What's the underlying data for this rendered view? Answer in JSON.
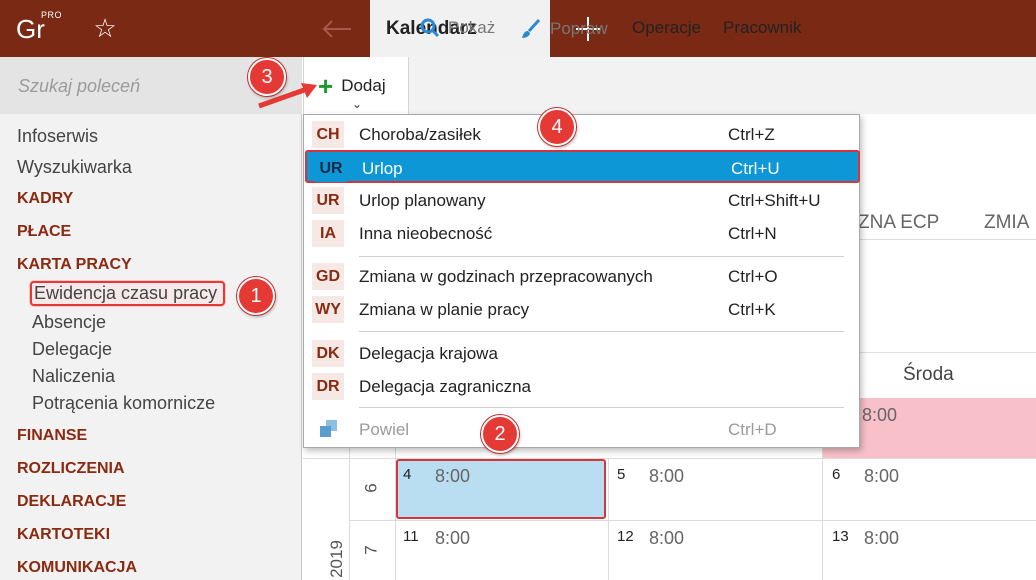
{
  "app": {
    "logo": "Gr",
    "logo_badge": "PRO"
  },
  "tabs": {
    "active": "Kalendarz"
  },
  "sidebar": {
    "search_placeholder": "Szukaj poleceń",
    "items": [
      "Infoserwis",
      "Wyszukiwarka"
    ],
    "sections": [
      "KADRY",
      "PŁACE",
      "KARTA PRACY",
      "FINANSE",
      "ROZLICZENIA",
      "DEKLARACJE",
      "KARTOTEKI",
      "KOMUNIKACJA"
    ],
    "sub": [
      "Ewidencja czasu pracy",
      "Absencje",
      "Delegacje",
      "Naliczenia",
      "Potrącenia komornicze"
    ]
  },
  "toolbar": {
    "dodaj": "Dodaj",
    "pokaz": "Pokaż",
    "popraw": "Popraw",
    "operacje": "Operacje",
    "pracownik": "Pracownik"
  },
  "menu": {
    "items": [
      {
        "code": "CH",
        "label": "Choroba/zasiłek",
        "shortcut": "Ctrl+Z"
      },
      {
        "code": "UR",
        "label": "Urlop",
        "shortcut": "Ctrl+U"
      },
      {
        "code": "UR",
        "label": "Urlop planowany",
        "shortcut": "Ctrl+Shift+U"
      },
      {
        "code": "IA",
        "label": "Inna nieobecność",
        "shortcut": "Ctrl+N"
      },
      {
        "code": "GD",
        "label": "Zmiana w godzinach przepracowanych",
        "shortcut": "Ctrl+O"
      },
      {
        "code": "WY",
        "label": "Zmiana w planie pracy",
        "shortcut": "Ctrl+K"
      },
      {
        "code": "DK",
        "label": "Delegacja krajowa",
        "shortcut": ""
      },
      {
        "code": "DR",
        "label": "Delegacja zagraniczna",
        "shortcut": ""
      },
      {
        "code": "",
        "label": "Powiel",
        "shortcut": "Ctrl+D"
      }
    ]
  },
  "calendar": {
    "headers": [
      "ZNA ECP",
      "ZMIA"
    ],
    "day_name": "Środa",
    "year": "2019",
    "weeks": [
      "6",
      "7"
    ],
    "rows": [
      {
        "cells": [
          {
            "n": "4",
            "t": "8:00"
          },
          {
            "n": "5",
            "t": "8:00"
          },
          {
            "n": "6",
            "t": "8:00"
          }
        ]
      },
      {
        "cells": [
          {
            "n": "11",
            "t": "8:00"
          },
          {
            "n": "12",
            "t": "8:00"
          },
          {
            "n": "13",
            "t": "8:00"
          }
        ]
      }
    ],
    "pink_time": "8:00"
  },
  "badges": [
    "1",
    "2",
    "3",
    "4"
  ],
  "colors": {
    "brand": "#7a2a14",
    "accent": "#0d97d6",
    "marker": "#e53935"
  }
}
